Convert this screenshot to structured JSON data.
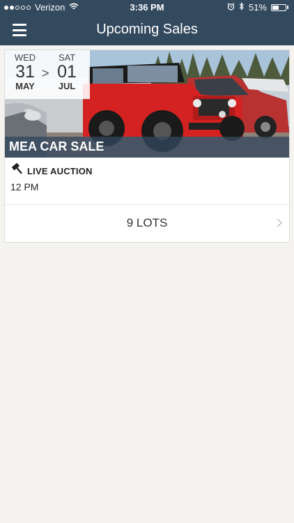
{
  "status_bar": {
    "carrier": "Verizon",
    "time": "3:36 PM",
    "battery": "51%",
    "battery_level": 0.51,
    "signal_bars": 2,
    "signal_total": 5
  },
  "nav": {
    "title": "Upcoming Sales"
  },
  "sale": {
    "start": {
      "dow": "WED",
      "day": "31",
      "month": "MAY"
    },
    "separator": ">",
    "end": {
      "dow": "SAT",
      "day": "01",
      "month": "JUL"
    },
    "title": "MEA CAR SALE",
    "auction_type": "LIVE AUCTION",
    "time": "12 PM",
    "lots": "9 LOTS"
  },
  "colors": {
    "header": "#33495e",
    "background": "#f4f3f0",
    "title_overlay": "#34485e"
  },
  "icons": {
    "menu": "hamburger-menu-icon",
    "auction": "gavel-icon",
    "chevron": "chevron-right-icon",
    "wifi": "wifi-icon",
    "alarm": "alarm-icon",
    "bluetooth": "bluetooth-icon"
  }
}
